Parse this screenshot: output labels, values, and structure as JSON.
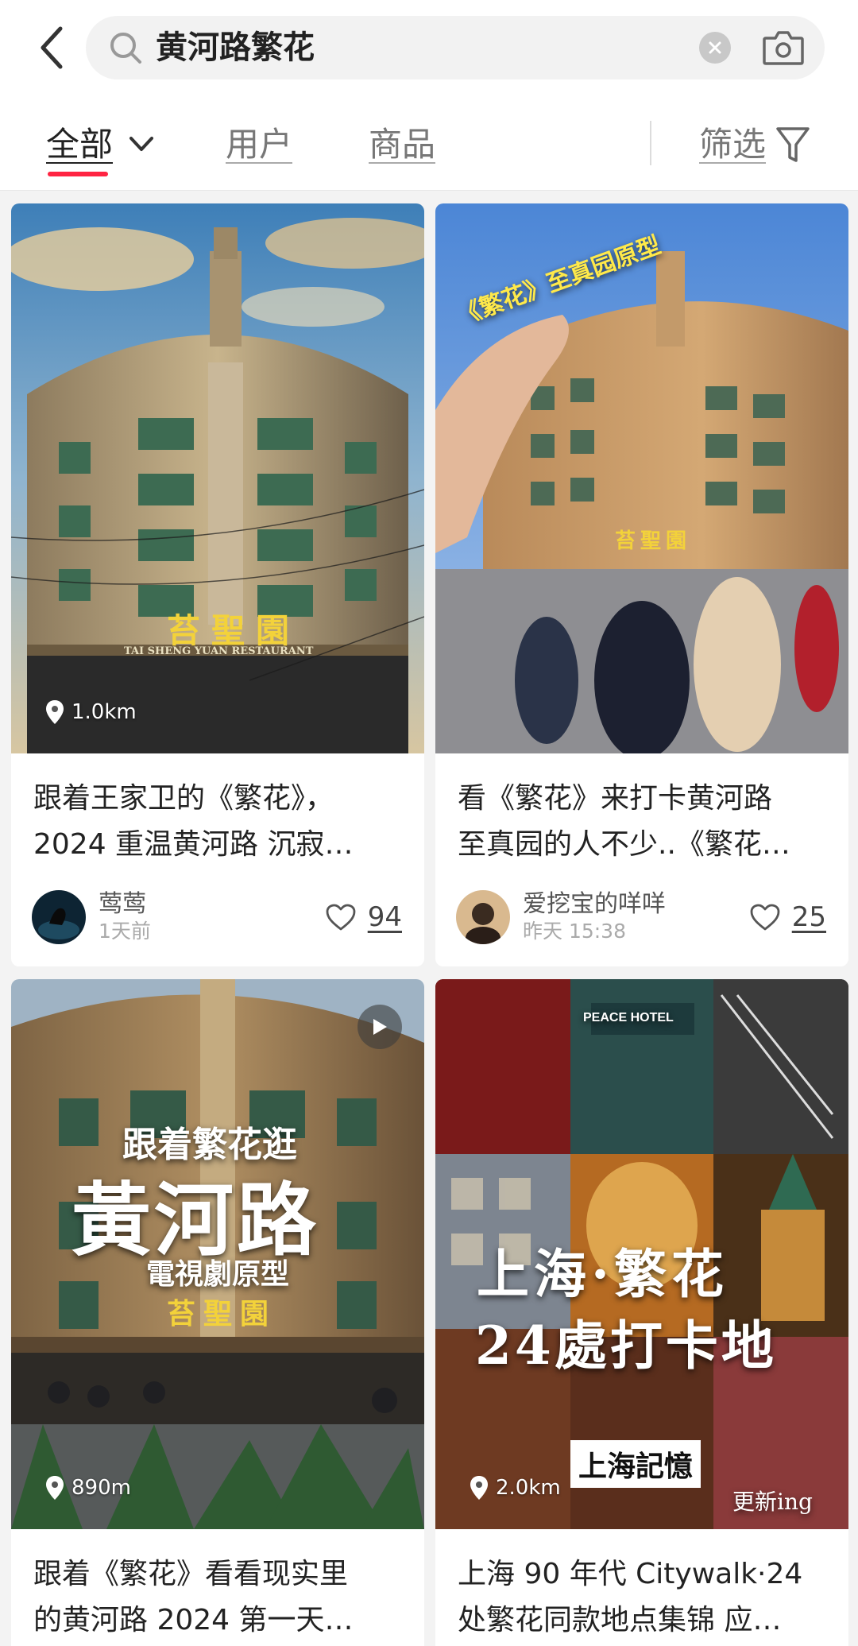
{
  "search": {
    "query": "黄河路繁花"
  },
  "tabs": {
    "all": "全部",
    "users": "用户",
    "goods": "商品",
    "filter": "筛选"
  },
  "colors": {
    "accent": "#ff2442",
    "sign_gold": "#f3d23a"
  },
  "icons": [
    "back-icon",
    "search-icon",
    "clear-icon",
    "camera-icon",
    "chevron-down-icon",
    "filter-icon",
    "location-pin-icon",
    "heart-icon",
    "play-icon"
  ],
  "feed": [
    {
      "distance": "1.0km",
      "title_line1": "跟着王家卫的《繁花》，",
      "title_line2": "2024 重温黄河路 沉寂…",
      "author": "莺莺",
      "time": "1天前",
      "likes": "94",
      "sign": "苔聖園",
      "sign_sub": "TAI SHENG YUAN RESTAURANT"
    },
    {
      "distance": "",
      "title_line1": "看《繁花》来打卡黄河路",
      "title_line2": "至真园的人不少..《繁花…",
      "author": "爱挖宝的咩咩",
      "time": "昨天 15:38",
      "likes": "25",
      "overlay": "《繁花》至真园原型",
      "sign": "苔聖園"
    },
    {
      "distance": "890m",
      "title_line1": "跟着《繁花》看看现实里",
      "title_line2": "的黄河路 2024 第一天…",
      "overlay_small": "跟着繁花逛",
      "overlay_big": "黃河路",
      "overlay_sub": "電視劇原型",
      "sign": "苔聖園"
    },
    {
      "distance": "2.0km",
      "title_line1": "上海 90 年代 Citywalk·24",
      "title_line2": "处繁花同款地点集锦 应…",
      "overlay_line1": "上海·繁花",
      "overlay_line2": "24處打卡地",
      "stamp": "上海記憶",
      "corner": "更新ing",
      "hotel_sign": "PEACE HOTEL"
    }
  ]
}
